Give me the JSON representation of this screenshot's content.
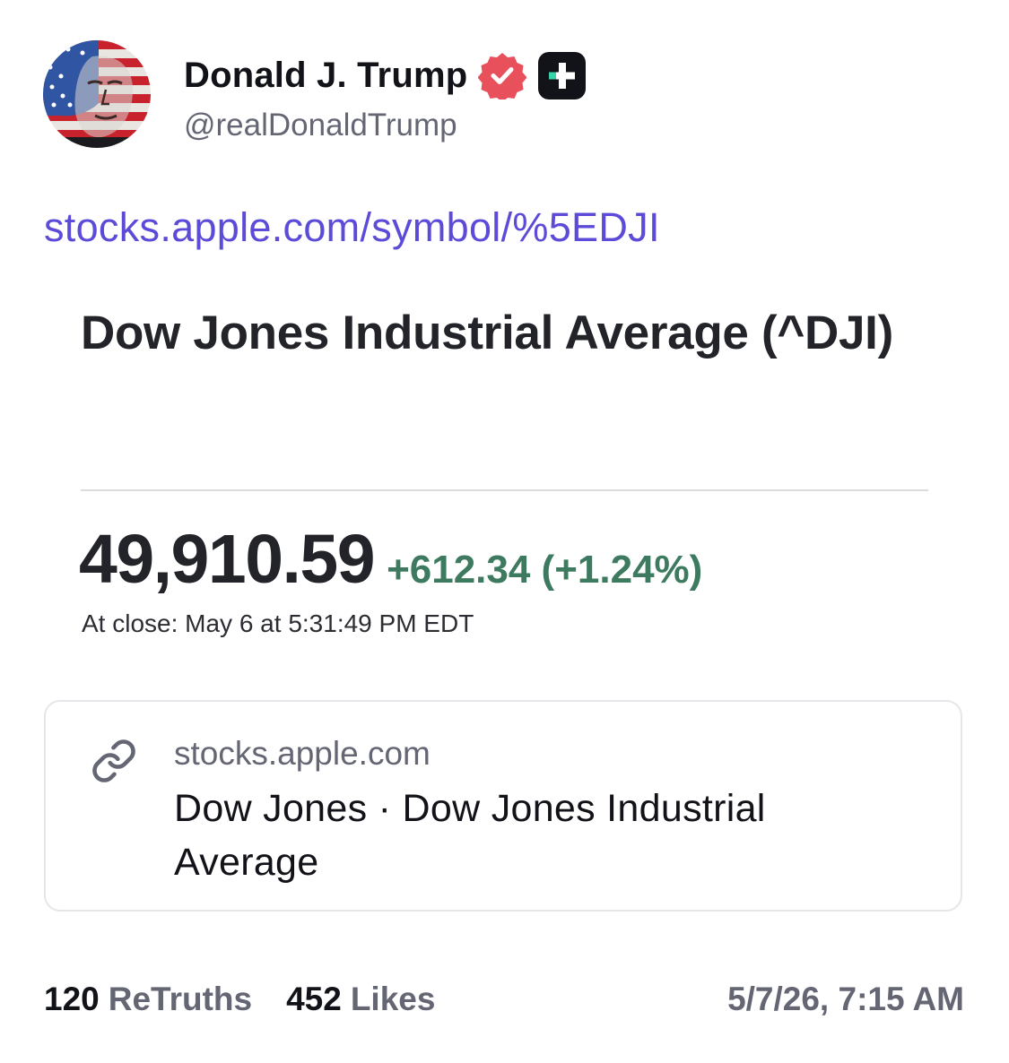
{
  "author": {
    "display_name": "Donald J. Trump",
    "handle": "@realDonaldTrump",
    "avatar_icon": "flag-portrait-avatar",
    "verified_icon": "verified-badge-icon",
    "badge_icon": "plus-badge-icon"
  },
  "post": {
    "link_text": "stocks.apple.com/symbol/%5EDJI"
  },
  "quote": {
    "title": "Dow Jones Industrial Average (^DJI)",
    "price": "49,910.59",
    "change": "+612.34 (+1.24%)",
    "close_time": "At close: May 6 at 5:31:49 PM EDT"
  },
  "link_card": {
    "icon": "link-icon",
    "domain": "stocks.apple.com",
    "title": "Dow Jones · Dow Jones Industrial Average"
  },
  "stats": {
    "retruths_count": "120",
    "retruths_label": "ReTruths",
    "likes_count": "452",
    "likes_label": "Likes"
  },
  "timestamp": "5/7/26, 7:15 AM",
  "colors": {
    "link": "#5b4bd8",
    "verified": "#e8505b",
    "positive_change": "#3d7a5f",
    "muted_text": "#646673"
  }
}
